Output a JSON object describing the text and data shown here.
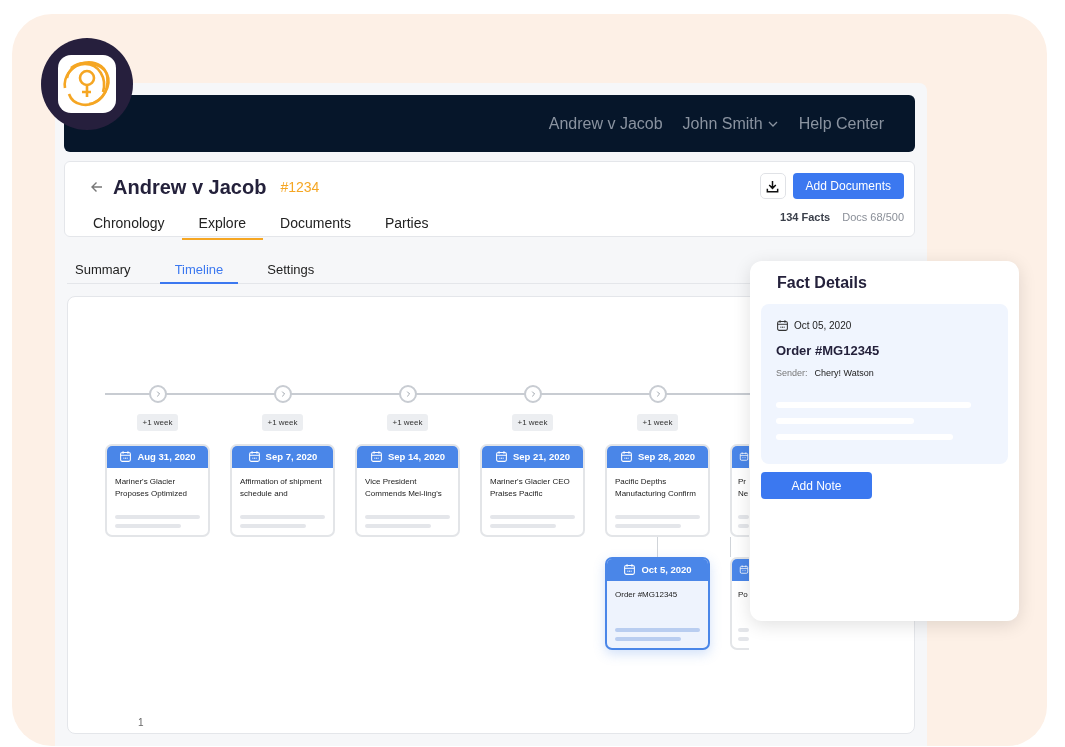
{
  "navbar": {
    "case_link": "Andrew v Jacob",
    "user_menu": "John Smith",
    "help_link": "Help Center"
  },
  "case_header": {
    "title": "Andrew v Jacob",
    "case_number": "#1234",
    "add_button": "Add Documents",
    "facts_count": "134 Facts",
    "docs_usage": "Docs 68/500"
  },
  "tabs": [
    {
      "label": "Chronology",
      "selected": false
    },
    {
      "label": "Explore",
      "selected": true
    },
    {
      "label": "Documents",
      "selected": false
    },
    {
      "label": "Parties",
      "selected": false
    }
  ],
  "subtabs": [
    {
      "label": "Summary",
      "selected": false
    },
    {
      "label": "Timeline",
      "selected": true
    },
    {
      "label": "Settings",
      "selected": false
    }
  ],
  "timeline": {
    "columns": [
      {
        "badge": "+1 week",
        "cards": [
          {
            "date": "Aug 31, 2020",
            "lines": [
              "Mariner's Glacier",
              "Proposes Optimized"
            ],
            "selected": false
          }
        ]
      },
      {
        "badge": "+1 week",
        "cards": [
          {
            "date": "Sep 7, 2020",
            "lines": [
              "Affirmation of shipment",
              "schedule and"
            ],
            "selected": false
          }
        ]
      },
      {
        "badge": "+1 week",
        "cards": [
          {
            "date": "Sep 14, 2020",
            "lines": [
              "Vice President",
              "Commends Mei-ling's"
            ],
            "selected": false
          }
        ]
      },
      {
        "badge": "+1 week",
        "cards": [
          {
            "date": "Sep 21, 2020",
            "lines": [
              "Mariner's Glacier CEO",
              "Praises Pacific"
            ],
            "selected": false
          }
        ]
      },
      {
        "badge": "+1 week",
        "cards": [
          {
            "date": "Sep 28, 2020",
            "lines": [
              "Pacific Depths",
              "Manufacturing Confirm"
            ],
            "selected": false
          },
          {
            "date": "Oct 5, 2020",
            "lines": [
              "Order #MG12345"
            ],
            "selected": true
          }
        ]
      },
      {
        "cards": [
          {
            "lines": [
              "Pr",
              "Ne"
            ],
            "selected": false
          },
          {
            "lines": [
              "Po"
            ],
            "selected": false
          }
        ]
      }
    ],
    "page": "1"
  },
  "fact_details": {
    "title": "Fact Details",
    "date": "Oct 05, 2020",
    "fact_title": "Order #MG12345",
    "sender_label": "Sender:",
    "sender": "Chery! Watson",
    "button": "Add Note"
  }
}
